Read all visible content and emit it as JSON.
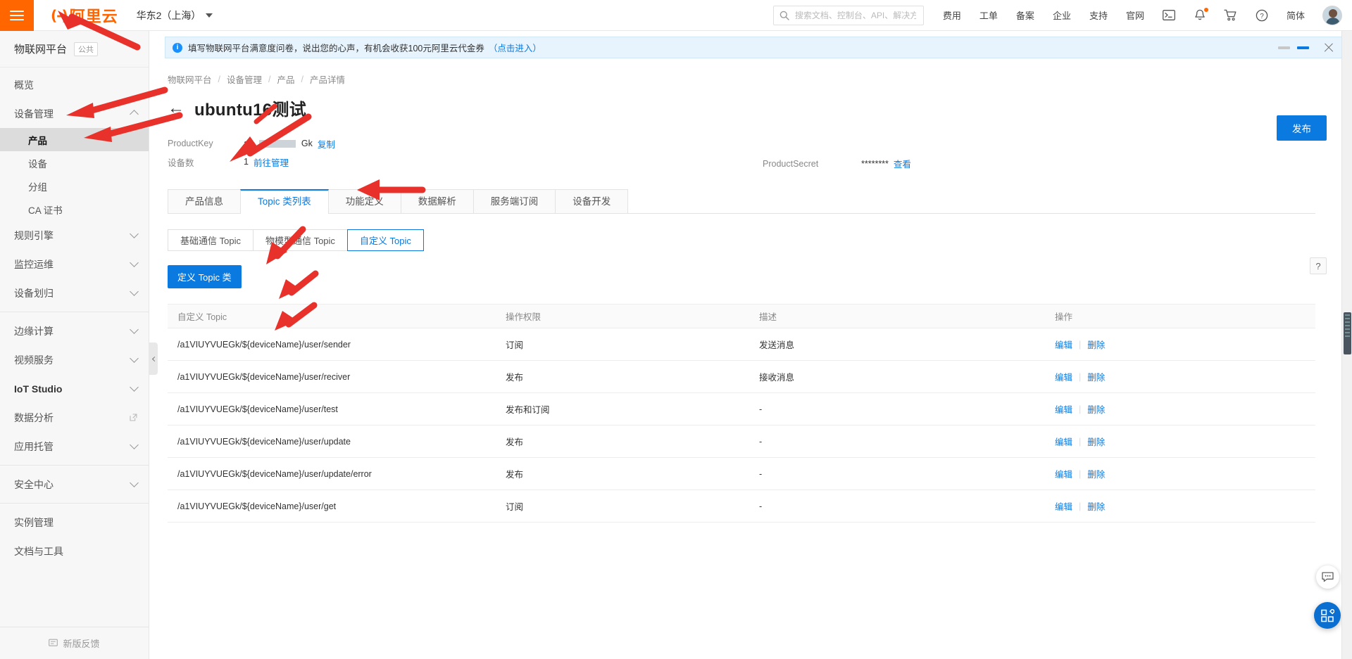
{
  "topbar": {
    "menu_icon": "hamburger-icon",
    "logo_mark": "(-)",
    "logo_text": "阿里云",
    "region": "华东2（上海）",
    "search_placeholder": "搜索文档、控制台、API、解决方案和资源",
    "nav_links": [
      "费用",
      "工单",
      "备案",
      "企业",
      "支持",
      "官网"
    ],
    "icons": [
      "terminal-icon",
      "bell-icon",
      "cart-icon",
      "question-icon"
    ],
    "language": "简体",
    "avatar": "user-avatar"
  },
  "sidebar": {
    "product_name": "物联网平台",
    "product_tag": "公共",
    "items": [
      {
        "label": "概览",
        "type": "link"
      },
      {
        "label": "设备管理",
        "type": "group",
        "expanded": true,
        "bold": false
      },
      {
        "label": "产品",
        "type": "sub",
        "active": true
      },
      {
        "label": "设备",
        "type": "sub",
        "active": false
      },
      {
        "label": "分组",
        "type": "sub",
        "active": false
      },
      {
        "label": "CA 证书",
        "type": "sub",
        "active": false
      },
      {
        "label": "规则引擎",
        "type": "group",
        "expanded": false
      },
      {
        "label": "监控运维",
        "type": "group",
        "expanded": false
      },
      {
        "label": "设备划归",
        "type": "group",
        "expanded": false
      },
      {
        "label": "边缘计算",
        "type": "group",
        "expanded": false
      },
      {
        "label": "视频服务",
        "type": "group",
        "expanded": false
      },
      {
        "label": "IoT Studio",
        "type": "group",
        "expanded": false,
        "bold": true
      },
      {
        "label": "数据分析",
        "type": "external"
      },
      {
        "label": "应用托管",
        "type": "group",
        "expanded": false
      },
      {
        "label": "安全中心",
        "type": "group",
        "expanded": false
      },
      {
        "label": "实例管理",
        "type": "link"
      },
      {
        "label": "文档与工具",
        "type": "link"
      }
    ],
    "footer_label": "新版反馈"
  },
  "notice": {
    "text": "填写物联网平台满意度问卷，说出您的心声，有机会收获100元阿里云代金券",
    "link": "（点击进入）",
    "icon": "info-icon"
  },
  "breadcrumb": [
    "物联网平台",
    "设备管理",
    "产品",
    "产品详情"
  ],
  "page": {
    "title": "ubuntu16测试",
    "back_icon": "back-arrow-icon",
    "publish_button": "发布",
    "meta": {
      "product_key_label": "ProductKey",
      "product_key_prefix": "a1",
      "product_key_suffix": "Gk",
      "copy_link": "复制",
      "device_count_label": "设备数",
      "device_count": "1",
      "device_manage_link": "前往管理",
      "product_secret_label": "ProductSecret",
      "product_secret_value": "********",
      "product_secret_link": "查看"
    }
  },
  "tabs": [
    {
      "label": "产品信息",
      "active": false
    },
    {
      "label": "Topic 类列表",
      "active": true
    },
    {
      "label": "功能定义",
      "active": false
    },
    {
      "label": "数据解析",
      "active": false
    },
    {
      "label": "服务端订阅",
      "active": false
    },
    {
      "label": "设备开发",
      "active": false
    }
  ],
  "subtabs": [
    {
      "label": "基础通信 Topic",
      "active": false
    },
    {
      "label": "物模型通信 Topic",
      "active": false
    },
    {
      "label": "自定义 Topic",
      "active": true
    }
  ],
  "toolbar": {
    "define_topic_button": "定义 Topic 类",
    "help_button": "?"
  },
  "table": {
    "columns": [
      "自定义 Topic",
      "操作权限",
      "描述",
      "操作"
    ],
    "actions": {
      "edit": "编辑",
      "delete": "删除",
      "separator": "|"
    },
    "rows": [
      {
        "topic": "/a1VIUYVUEGk/${deviceName}/user/sender",
        "permission": "订阅",
        "desc": "发送消息"
      },
      {
        "topic": "/a1VIUYVUEGk/${deviceName}/user/reciver",
        "permission": "发布",
        "desc": "接收消息"
      },
      {
        "topic": "/a1VIUYVUEGk/${deviceName}/user/test",
        "permission": "发布和订阅",
        "desc": "-"
      },
      {
        "topic": "/a1VIUYVUEGk/${deviceName}/user/update",
        "permission": "发布",
        "desc": "-"
      },
      {
        "topic": "/a1VIUYVUEGk/${deviceName}/user/update/error",
        "permission": "发布",
        "desc": "-"
      },
      {
        "topic": "/a1VIUYVUEGk/${deviceName}/user/get",
        "permission": "订阅",
        "desc": "-"
      }
    ]
  },
  "floating": {
    "chat_icon": "chat-bubble-icon",
    "apps_icon": "apps-grid-icon"
  },
  "colors": {
    "brand_orange": "#FF6600",
    "primary_blue": "#0A7AE0",
    "notice_bg": "#E8F4FD",
    "sidebar_bg": "#F7F7F7",
    "annotation_red": "#E8312A"
  }
}
